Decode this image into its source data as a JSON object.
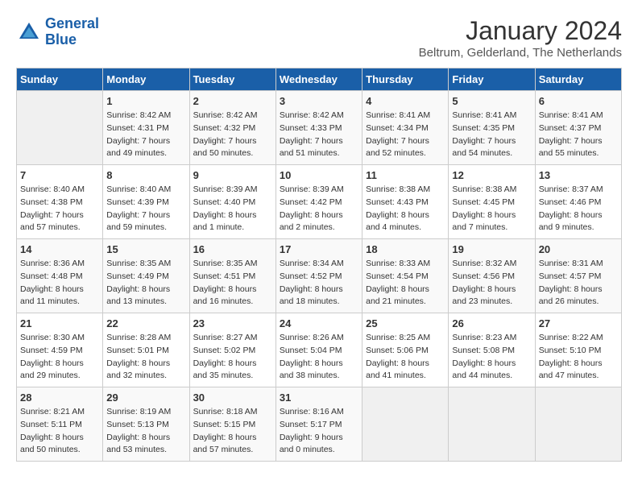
{
  "logo": {
    "text_general": "General",
    "text_blue": "Blue"
  },
  "header": {
    "month": "January 2024",
    "location": "Beltrum, Gelderland, The Netherlands"
  },
  "days_of_week": [
    "Sunday",
    "Monday",
    "Tuesday",
    "Wednesday",
    "Thursday",
    "Friday",
    "Saturday"
  ],
  "weeks": [
    [
      {
        "day": "",
        "sunrise": "",
        "sunset": "",
        "daylight": ""
      },
      {
        "day": "1",
        "sunrise": "Sunrise: 8:42 AM",
        "sunset": "Sunset: 4:31 PM",
        "daylight": "Daylight: 7 hours and 49 minutes."
      },
      {
        "day": "2",
        "sunrise": "Sunrise: 8:42 AM",
        "sunset": "Sunset: 4:32 PM",
        "daylight": "Daylight: 7 hours and 50 minutes."
      },
      {
        "day": "3",
        "sunrise": "Sunrise: 8:42 AM",
        "sunset": "Sunset: 4:33 PM",
        "daylight": "Daylight: 7 hours and 51 minutes."
      },
      {
        "day": "4",
        "sunrise": "Sunrise: 8:41 AM",
        "sunset": "Sunset: 4:34 PM",
        "daylight": "Daylight: 7 hours and 52 minutes."
      },
      {
        "day": "5",
        "sunrise": "Sunrise: 8:41 AM",
        "sunset": "Sunset: 4:35 PM",
        "daylight": "Daylight: 7 hours and 54 minutes."
      },
      {
        "day": "6",
        "sunrise": "Sunrise: 8:41 AM",
        "sunset": "Sunset: 4:37 PM",
        "daylight": "Daylight: 7 hours and 55 minutes."
      }
    ],
    [
      {
        "day": "7",
        "sunrise": "Sunrise: 8:40 AM",
        "sunset": "Sunset: 4:38 PM",
        "daylight": "Daylight: 7 hours and 57 minutes."
      },
      {
        "day": "8",
        "sunrise": "Sunrise: 8:40 AM",
        "sunset": "Sunset: 4:39 PM",
        "daylight": "Daylight: 7 hours and 59 minutes."
      },
      {
        "day": "9",
        "sunrise": "Sunrise: 8:39 AM",
        "sunset": "Sunset: 4:40 PM",
        "daylight": "Daylight: 8 hours and 1 minute."
      },
      {
        "day": "10",
        "sunrise": "Sunrise: 8:39 AM",
        "sunset": "Sunset: 4:42 PM",
        "daylight": "Daylight: 8 hours and 2 minutes."
      },
      {
        "day": "11",
        "sunrise": "Sunrise: 8:38 AM",
        "sunset": "Sunset: 4:43 PM",
        "daylight": "Daylight: 8 hours and 4 minutes."
      },
      {
        "day": "12",
        "sunrise": "Sunrise: 8:38 AM",
        "sunset": "Sunset: 4:45 PM",
        "daylight": "Daylight: 8 hours and 7 minutes."
      },
      {
        "day": "13",
        "sunrise": "Sunrise: 8:37 AM",
        "sunset": "Sunset: 4:46 PM",
        "daylight": "Daylight: 8 hours and 9 minutes."
      }
    ],
    [
      {
        "day": "14",
        "sunrise": "Sunrise: 8:36 AM",
        "sunset": "Sunset: 4:48 PM",
        "daylight": "Daylight: 8 hours and 11 minutes."
      },
      {
        "day": "15",
        "sunrise": "Sunrise: 8:35 AM",
        "sunset": "Sunset: 4:49 PM",
        "daylight": "Daylight: 8 hours and 13 minutes."
      },
      {
        "day": "16",
        "sunrise": "Sunrise: 8:35 AM",
        "sunset": "Sunset: 4:51 PM",
        "daylight": "Daylight: 8 hours and 16 minutes."
      },
      {
        "day": "17",
        "sunrise": "Sunrise: 8:34 AM",
        "sunset": "Sunset: 4:52 PM",
        "daylight": "Daylight: 8 hours and 18 minutes."
      },
      {
        "day": "18",
        "sunrise": "Sunrise: 8:33 AM",
        "sunset": "Sunset: 4:54 PM",
        "daylight": "Daylight: 8 hours and 21 minutes."
      },
      {
        "day": "19",
        "sunrise": "Sunrise: 8:32 AM",
        "sunset": "Sunset: 4:56 PM",
        "daylight": "Daylight: 8 hours and 23 minutes."
      },
      {
        "day": "20",
        "sunrise": "Sunrise: 8:31 AM",
        "sunset": "Sunset: 4:57 PM",
        "daylight": "Daylight: 8 hours and 26 minutes."
      }
    ],
    [
      {
        "day": "21",
        "sunrise": "Sunrise: 8:30 AM",
        "sunset": "Sunset: 4:59 PM",
        "daylight": "Daylight: 8 hours and 29 minutes."
      },
      {
        "day": "22",
        "sunrise": "Sunrise: 8:28 AM",
        "sunset": "Sunset: 5:01 PM",
        "daylight": "Daylight: 8 hours and 32 minutes."
      },
      {
        "day": "23",
        "sunrise": "Sunrise: 8:27 AM",
        "sunset": "Sunset: 5:02 PM",
        "daylight": "Daylight: 8 hours and 35 minutes."
      },
      {
        "day": "24",
        "sunrise": "Sunrise: 8:26 AM",
        "sunset": "Sunset: 5:04 PM",
        "daylight": "Daylight: 8 hours and 38 minutes."
      },
      {
        "day": "25",
        "sunrise": "Sunrise: 8:25 AM",
        "sunset": "Sunset: 5:06 PM",
        "daylight": "Daylight: 8 hours and 41 minutes."
      },
      {
        "day": "26",
        "sunrise": "Sunrise: 8:23 AM",
        "sunset": "Sunset: 5:08 PM",
        "daylight": "Daylight: 8 hours and 44 minutes."
      },
      {
        "day": "27",
        "sunrise": "Sunrise: 8:22 AM",
        "sunset": "Sunset: 5:10 PM",
        "daylight": "Daylight: 8 hours and 47 minutes."
      }
    ],
    [
      {
        "day": "28",
        "sunrise": "Sunrise: 8:21 AM",
        "sunset": "Sunset: 5:11 PM",
        "daylight": "Daylight: 8 hours and 50 minutes."
      },
      {
        "day": "29",
        "sunrise": "Sunrise: 8:19 AM",
        "sunset": "Sunset: 5:13 PM",
        "daylight": "Daylight: 8 hours and 53 minutes."
      },
      {
        "day": "30",
        "sunrise": "Sunrise: 8:18 AM",
        "sunset": "Sunset: 5:15 PM",
        "daylight": "Daylight: 8 hours and 57 minutes."
      },
      {
        "day": "31",
        "sunrise": "Sunrise: 8:16 AM",
        "sunset": "Sunset: 5:17 PM",
        "daylight": "Daylight: 9 hours and 0 minutes."
      },
      {
        "day": "",
        "sunrise": "",
        "sunset": "",
        "daylight": ""
      },
      {
        "day": "",
        "sunrise": "",
        "sunset": "",
        "daylight": ""
      },
      {
        "day": "",
        "sunrise": "",
        "sunset": "",
        "daylight": ""
      }
    ]
  ]
}
